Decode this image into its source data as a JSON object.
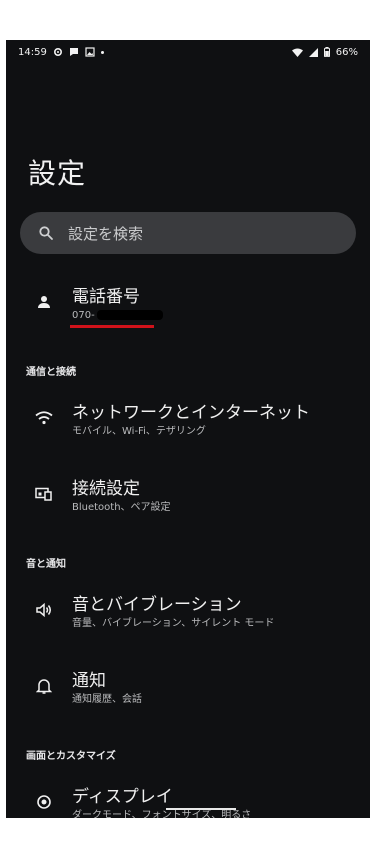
{
  "status_bar": {
    "time": "14:59",
    "battery": "66%"
  },
  "page": {
    "title": "設定"
  },
  "search": {
    "placeholder": "設定を検索"
  },
  "phone_number": {
    "title": "電話番号",
    "number_prefix": "070-"
  },
  "sections": [
    {
      "header": "通信と接続",
      "items": [
        {
          "title": "ネットワークとインターネット",
          "subtitle": "モバイル、Wi-Fi、テザリング",
          "icon": "wifi-icon"
        },
        {
          "title": "接続設定",
          "subtitle": "Bluetooth、ペア設定",
          "icon": "connected-devices-icon"
        }
      ]
    },
    {
      "header": "音と通知",
      "items": [
        {
          "title": "音とバイブレーション",
          "subtitle": "音量、バイブレーション、サイレント モード",
          "icon": "volume-icon"
        },
        {
          "title": "通知",
          "subtitle": "通知履歴、会話",
          "icon": "bell-icon"
        }
      ]
    },
    {
      "header": "画面とカスタマイズ",
      "items": [
        {
          "title": "ディスプレイ",
          "subtitle": "ダークモード、フォントサイズ、明るさ",
          "icon": "display-gear-icon"
        }
      ]
    }
  ],
  "colors": {
    "background": "#0f1012",
    "search_bg": "#3a3b3e",
    "redline": "#d0121a"
  }
}
